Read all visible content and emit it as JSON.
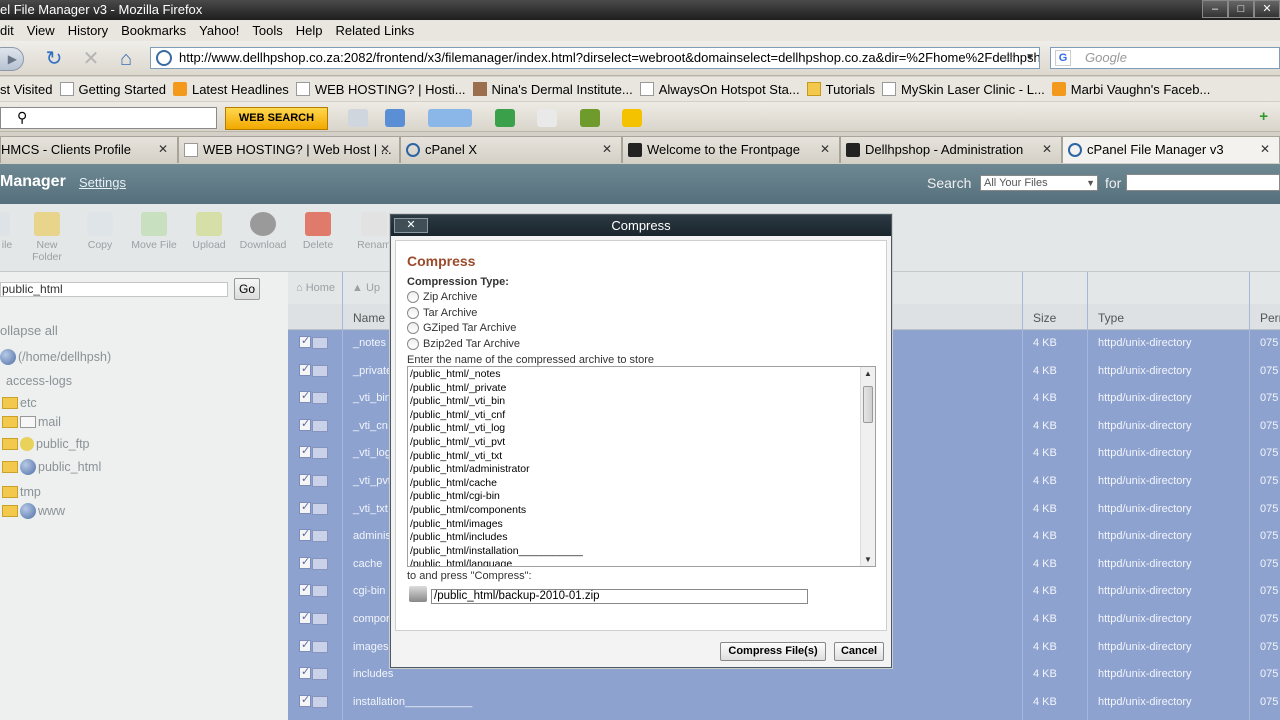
{
  "window": {
    "title": "el File Manager v3 - Mozilla Firefox",
    "buttons": [
      "–",
      "□",
      "✕"
    ]
  },
  "menu": [
    "dit",
    "View",
    "History",
    "Bookmarks",
    "Yahoo!",
    "Tools",
    "Help",
    "Related Links"
  ],
  "nav": {
    "url": "http://www.dellhpshop.co.za:2082/frontend/x3/filemanager/index.html?dirselect=webroot&domainselect=dellhpshop.co.za&dir=%2Fhome%2Fdellhpsh?",
    "search_placeholder": "Google",
    "search_engine_icon": "g-icon"
  },
  "bookmarks": [
    {
      "label": "st Visited",
      "icon": "none"
    },
    {
      "label": "Getting Started",
      "icon": "page"
    },
    {
      "label": "Latest Headlines",
      "icon": "rss"
    },
    {
      "label": "WEB HOSTING? | Hosti...",
      "icon": "page"
    },
    {
      "label": "Nina's Dermal Institute...",
      "icon": "photo"
    },
    {
      "label": "AlwaysOn Hotspot Sta...",
      "icon": "page"
    },
    {
      "label": "Tutorials",
      "icon": "folder"
    },
    {
      "label": "MySkin Laser Clinic - L...",
      "icon": "page"
    },
    {
      "label": "Marbi Vaughn's Faceb...",
      "icon": "rss"
    }
  ],
  "toolbar": {
    "web_search_label": "WEB SEARCH"
  },
  "tabs": [
    {
      "label": "HMCS - Clients Profile",
      "icon": "none",
      "active": false
    },
    {
      "label": "WEB HOSTING? | Web Host | ...",
      "icon": "page",
      "active": false
    },
    {
      "label": "cPanel X",
      "icon": "cpanel",
      "active": false
    },
    {
      "label": "Welcome to the Frontpage",
      "icon": "joomla",
      "active": false
    },
    {
      "label": "Dellhpshop - Administration",
      "icon": "joomla",
      "active": false
    },
    {
      "label": "cPanel File Manager v3",
      "icon": "cpanel",
      "active": true
    }
  ],
  "cpanel": {
    "title": "Manager",
    "settings_label": "Settings",
    "search_label": "Search",
    "search_scope": "All Your Files",
    "for_label": "for"
  },
  "file_toolbar": [
    {
      "label": "ile"
    },
    {
      "label": "New Folder"
    },
    {
      "label": "Copy"
    },
    {
      "label": "Move File"
    },
    {
      "label": "Upload"
    },
    {
      "label": "Download"
    },
    {
      "label": "Delete"
    },
    {
      "label": "Renam"
    }
  ],
  "left": {
    "path": "public_html",
    "go_label": "Go",
    "collapse_label": "ollapse all",
    "tree": [
      {
        "label": "(/home/dellhpsh)",
        "icon": "home"
      },
      {
        "label": "access-logs",
        "icon": "none"
      },
      {
        "label": "etc",
        "icon": "folder"
      },
      {
        "label": "mail",
        "icon": "mail"
      },
      {
        "label": "public_ftp",
        "icon": "ftp"
      },
      {
        "label": "public_html",
        "icon": "globe"
      },
      {
        "label": "tmp",
        "icon": "folder"
      },
      {
        "label": "www",
        "icon": "globe"
      }
    ]
  },
  "right": {
    "home_label": "Home",
    "up_label": "Up",
    "columns": {
      "name": "Name",
      "size": "Size",
      "type": "Type",
      "perm": "Perm"
    },
    "rows": [
      {
        "name": "_notes",
        "size": "4 KB",
        "type": "httpd/unix-directory",
        "perm": "075"
      },
      {
        "name": "_private",
        "size": "4 KB",
        "type": "httpd/unix-directory",
        "perm": "075"
      },
      {
        "name": "_vti_bin",
        "size": "4 KB",
        "type": "httpd/unix-directory",
        "perm": "075"
      },
      {
        "name": "_vti_cn",
        "size": "4 KB",
        "type": "httpd/unix-directory",
        "perm": "075"
      },
      {
        "name": "_vti_log",
        "size": "4 KB",
        "type": "httpd/unix-directory",
        "perm": "075"
      },
      {
        "name": "_vti_pvt",
        "size": "4 KB",
        "type": "httpd/unix-directory",
        "perm": "075"
      },
      {
        "name": "_vti_txt",
        "size": "4 KB",
        "type": "httpd/unix-directory",
        "perm": "075"
      },
      {
        "name": "adminis",
        "size": "4 KB",
        "type": "httpd/unix-directory",
        "perm": "075"
      },
      {
        "name": "cache",
        "size": "4 KB",
        "type": "httpd/unix-directory",
        "perm": "075"
      },
      {
        "name": "cgi-bin",
        "size": "4 KB",
        "type": "httpd/unix-directory",
        "perm": "075"
      },
      {
        "name": "compor",
        "size": "4 KB",
        "type": "httpd/unix-directory",
        "perm": "075"
      },
      {
        "name": "images",
        "size": "4 KB",
        "type": "httpd/unix-directory",
        "perm": "075"
      },
      {
        "name": "includes",
        "size": "4 KB",
        "type": "httpd/unix-directory",
        "perm": "075"
      },
      {
        "name": "installation___________",
        "size": "4 KB",
        "type": "httpd/unix-directory",
        "perm": "075"
      }
    ]
  },
  "dialog": {
    "title": "Compress",
    "close_label": "✕",
    "heading": "Compress",
    "type_label": "Compression Type:",
    "types": [
      "Zip Archive",
      "Tar Archive",
      "GZiped Tar Archive",
      "Bzip2ed Tar Archive"
    ],
    "instruction": "Enter the name of the compressed archive to store",
    "files": [
      "/public_html/_notes",
      "/public_html/_private",
      "/public_html/_vti_bin",
      "/public_html/_vti_cnf",
      "/public_html/_vti_log",
      "/public_html/_vti_pvt",
      "/public_html/_vti_txt",
      "/public_html/administrator",
      "/public_html/cache",
      "/public_html/cgi-bin",
      "/public_html/components",
      "/public_html/images",
      "/public_html/includes",
      "/public_html/installation___________",
      "/public_html/language"
    ],
    "instruction2": "to and press \"Compress\":",
    "archive_value": "/public_html/backup-2010-01.zip",
    "compress_label": "Compress File(s)",
    "cancel_label": "Cancel"
  }
}
